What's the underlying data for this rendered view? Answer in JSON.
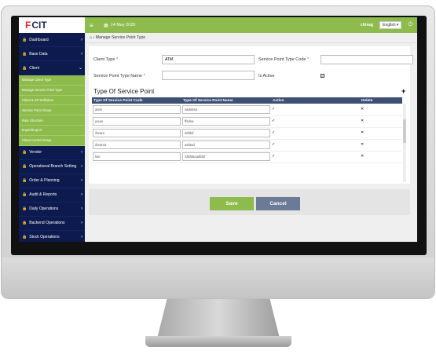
{
  "logo": {
    "mark": "F",
    "text": "CIT"
  },
  "topbar": {
    "date": "14 May 2020",
    "user": "chirag",
    "language": "English"
  },
  "sidebar": {
    "items": [
      {
        "label": "Dashboard"
      },
      {
        "label": "Base Data"
      },
      {
        "label": "Client"
      }
    ],
    "sub_items": [
      {
        "label": "Manage Client Type"
      },
      {
        "label": "Manage Service Point Type"
      },
      {
        "label": "Client & SP Definition"
      },
      {
        "label": "Service Point Group"
      },
      {
        "label": "Rate Structure"
      },
      {
        "label": "Import/Export"
      },
      {
        "label": "Client Control Setup"
      }
    ],
    "items_after": [
      {
        "label": "Vendor"
      },
      {
        "label": "Operational Branch Setting"
      },
      {
        "label": "Order & Planning"
      },
      {
        "label": "Audit & Reports"
      },
      {
        "label": "Daily Operations"
      },
      {
        "label": "Backend Operations"
      },
      {
        "label": "Stock Operations"
      }
    ]
  },
  "breadcrumb": {
    "page": "Manage Service Point Type"
  },
  "form": {
    "client_type_label": "Client Type",
    "client_type_value": "ATM",
    "sp_type_code_label": "Service Point Type Code",
    "sp_type_code_value": "",
    "sp_type_name_label": "Service Point Type Name",
    "sp_type_name_value": "",
    "is_active_label": "Is Active"
  },
  "section": {
    "title": "Type Of Service Point"
  },
  "table": {
    "headers": [
      "Type Of Service Point Code",
      "Type Of Service Point Name",
      "Active",
      "Delete"
    ],
    "rows": [
      {
        "code": "asds",
        "name": "sadsbsa"
      },
      {
        "code": "yuuw",
        "name": "ffsdsa"
      },
      {
        "code": "iforam",
        "name": "sdfdsf"
      },
      {
        "code": "iforam2",
        "name": "asfasd"
      },
      {
        "code": "kse",
        "name": "Xfdfdasadfdsf"
      }
    ]
  },
  "buttons": {
    "save": "Save",
    "cancel": "Cancel"
  }
}
